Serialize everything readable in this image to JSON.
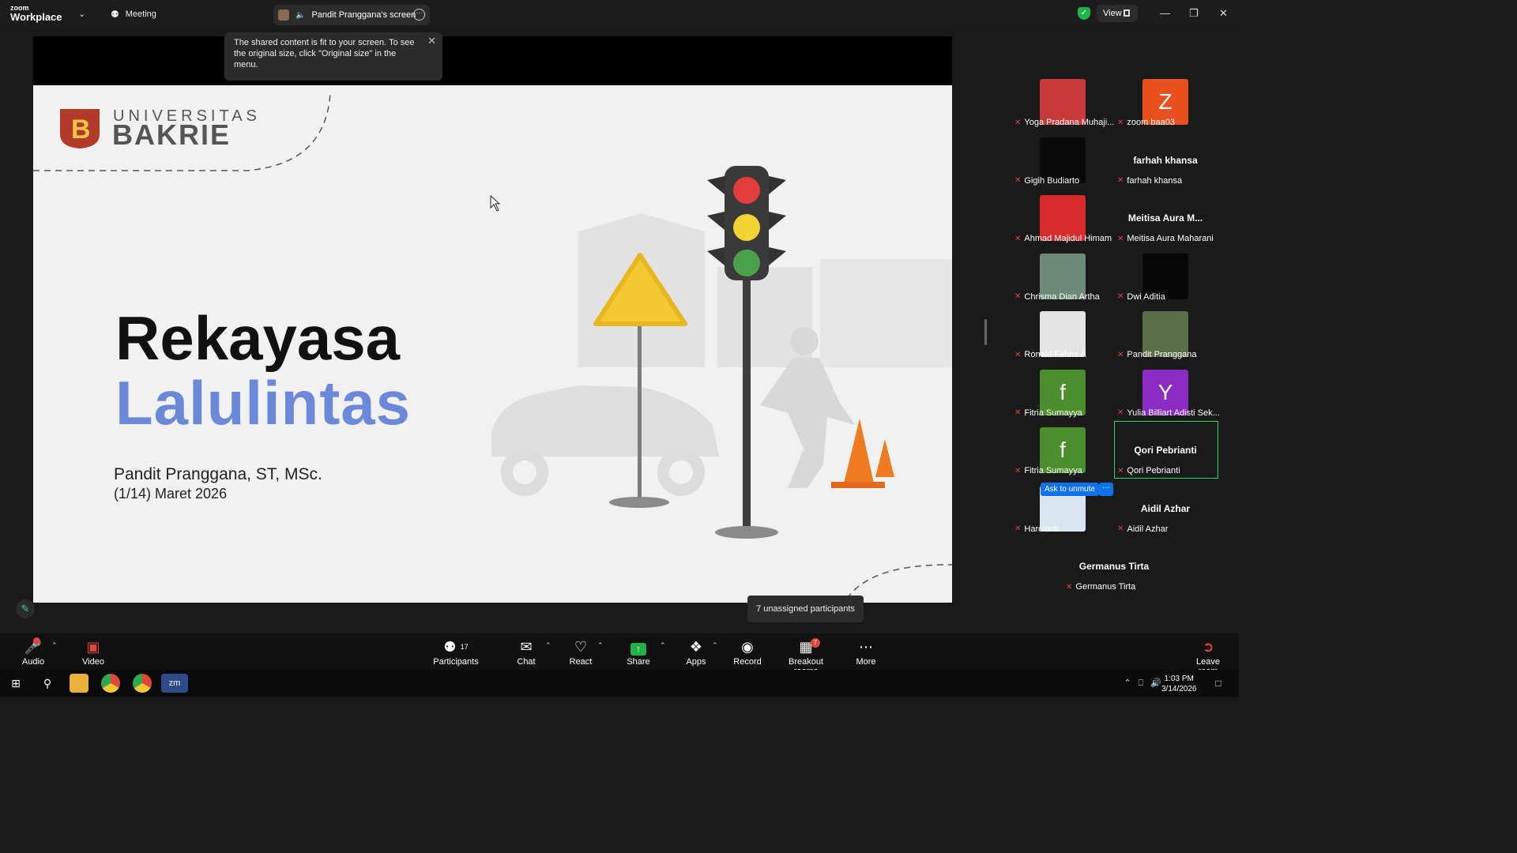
{
  "titlebar": {
    "logo_small": "zoom",
    "logo_big": "Workplace",
    "meeting_label": "Meeting",
    "screen_tab_label": "Pandit Pranggana's screen",
    "view_label": "View"
  },
  "share": {
    "tooltip": "The shared content is fit to your screen. To see the original size, click \"Original size\" in the menu.",
    "slide": {
      "uni_small": "UNIVERSITAS",
      "uni_big": "BAKRIE",
      "title_line1": "Rekayasa",
      "title_line2": "Lalulintas",
      "presenter": "Pandit Pranggana, ST, MSc.",
      "date": "(1/14) Maret 2026"
    }
  },
  "gallery": {
    "participants": [
      {
        "name": "Yoga Pradana Muhaji...",
        "thumb": "photo",
        "color": "#c83a3a"
      },
      {
        "name": "zoom baa03",
        "thumb": "letter",
        "letter": "Z",
        "color": "#e8501e"
      },
      {
        "name": "Gigih Budiarto",
        "thumb": "dark",
        "color": "#0a0a0a"
      },
      {
        "name": "farhah khansa",
        "thumb": "name",
        "display": "farhah khansa"
      },
      {
        "name": "Ahmad Majidul Himam",
        "thumb": "photo",
        "color": "#d72a2a"
      },
      {
        "name": "Meitisa Aura Maharani",
        "thumb": "name",
        "display": "Meitisa Aura M..."
      },
      {
        "name": "Chrisma Dian Artha",
        "thumb": "photo",
        "color": "#6d8a78"
      },
      {
        "name": "Dwi Aditia",
        "thumb": "dark",
        "color": "#070707"
      },
      {
        "name": "Ronald Fahmi A",
        "thumb": "photo",
        "color": "#e4e4e4"
      },
      {
        "name": "Pandit Pranggana",
        "thumb": "photo",
        "color": "#5a6e4a"
      },
      {
        "name": "Fitria Sumayya",
        "thumb": "letter",
        "letter": "f",
        "color": "#4a8f2c"
      },
      {
        "name": "Yulia Billiart Adisti Sek...",
        "thumb": "letter",
        "letter": "Y",
        "color": "#8a2bc4"
      },
      {
        "name": "Fitria Sumayya",
        "thumb": "letter",
        "letter": "f",
        "color": "#4a8f2c"
      },
      {
        "name": "Qori Pebrianti",
        "thumb": "name",
        "display": "Qori Pebrianti"
      },
      {
        "name": "Hardianti",
        "thumb": "light",
        "color": "#d7e6f0"
      },
      {
        "name": "Aidil Azhar",
        "thumb": "name",
        "display": "Aidil Azhar"
      },
      {
        "name": "Germanus Tirta",
        "thumb": "name",
        "display": "Germanus Tirta"
      }
    ],
    "ask_unmute": "Ask to unmute",
    "ask_more": "···"
  },
  "unassigned_tip": "7 unassigned participants",
  "toolbar": {
    "audio": "Audio",
    "video": "Video",
    "participants": "Participants",
    "participants_count": "17",
    "chat": "Chat",
    "react": "React",
    "share": "Share",
    "apps": "Apps",
    "record": "Record",
    "breakout": "Breakout rooms",
    "breakout_badge": "7",
    "more": "More",
    "leave": "Leave room"
  },
  "taskbar": {
    "time": "1:03 PM",
    "date": "3/14/2026"
  },
  "colors": {
    "accent_blue": "#0e72ed",
    "share_green": "#21b14b",
    "mute_red": "#e0463c",
    "title_blue": "#6b89d8",
    "active_speaker_border": "#1ed760"
  }
}
